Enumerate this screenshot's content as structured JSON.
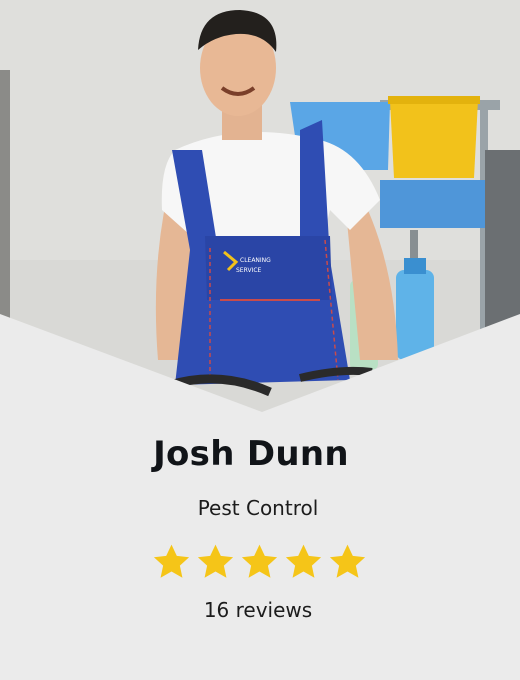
{
  "profile": {
    "name": "Josh Dunn",
    "service": "Pest Control",
    "rating": 5,
    "rating_max": 5,
    "reviews": "16 reviews",
    "photo_alt": "Man in blue overalls with cleaning cart",
    "badge_text": [
      "CLEANING",
      "SERVICE"
    ]
  },
  "colors": {
    "background": "#ebebeb",
    "star": "#f5c518",
    "name": "#111418",
    "text": "#1c1c1c",
    "overalls": "#2f4db3"
  },
  "icons": {
    "star": "star-icon"
  }
}
